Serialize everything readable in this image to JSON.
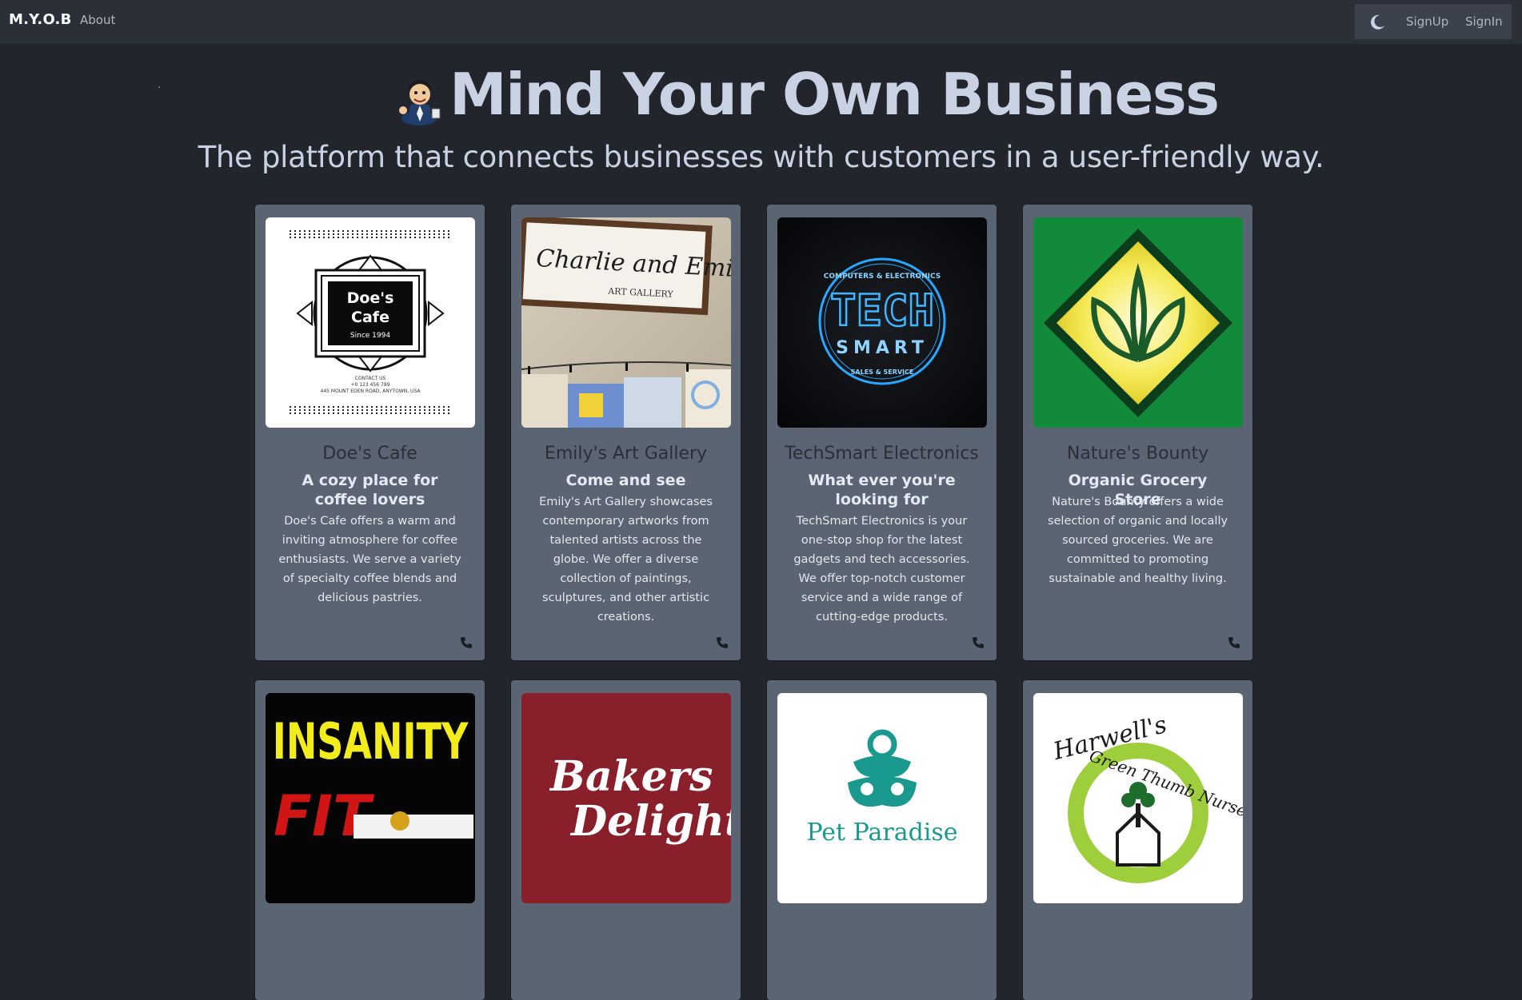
{
  "navbar": {
    "brand": "M.Y.O.B",
    "about": "About",
    "theme_icon": "moon-icon",
    "signup": "SignUp",
    "signin": "SignIn"
  },
  "hero": {
    "mascot_icon": "businessman-mascot-icon",
    "title": "Mind Your Own Business",
    "subtitle": "The platform that connects businesses with customers in a user-friendly way."
  },
  "businesses": [
    {
      "name": "Doe's Cafe",
      "tagline": "A cozy place for coffee lovers",
      "description": "Doe's Cafe offers a warm and inviting atmosphere for coffee enthusiasts. We serve a variety of specialty coffee blends and delicious pastries.",
      "logo_text": {
        "line1": "Doe's",
        "line2": "Cafe",
        "since": "Since 1994",
        "contact": "CONTACT US",
        "phone": "+0 123 456 789",
        "address": "445 MOUNT EDEN ROAD, ANYTOWN, USA"
      },
      "contact_icon": "phone-icon"
    },
    {
      "name": "Emily's Art Gallery",
      "tagline": "Come and see",
      "description": "Emily's Art Gallery showcases contemporary artworks from talented artists across the globe. We offer a diverse collection of paintings, sculptures, and other artistic creations.",
      "logo_text": {
        "line1": "Charlie and Emily's",
        "line2": "ART GALLERY"
      },
      "contact_icon": "phone-icon"
    },
    {
      "name": "TechSmart Electronics",
      "tagline": "What ever you're looking for",
      "description": "TechSmart Electronics is your one-stop shop for the latest gadgets and tech accessories. We offer top-notch customer service and a wide range of cutting-edge products.",
      "logo_text": {
        "top": "COMPUTERS & ELECTRONICS",
        "line1": "TECH",
        "line2": "SMART",
        "bottom": "SALES & SERVICE"
      },
      "contact_icon": "phone-icon"
    },
    {
      "name": "Nature's Bounty",
      "tagline": "Organic Grocery Store",
      "description": "Nature's Bounty offers a wide selection of organic and locally sourced groceries. We are committed to promoting sustainable and healthy living.",
      "contact_icon": "phone-icon"
    },
    {
      "logo_text": {
        "line1": "INSANITY",
        "line2": "FIT"
      }
    },
    {
      "logo_text": {
        "line1": "Bakers",
        "line2": "Delight"
      }
    },
    {
      "logo_text": {
        "line1": "Pet Paradise"
      }
    },
    {
      "logo_text": {
        "line1": "Harwell's",
        "line2": "Green Thumb Nursery"
      }
    }
  ],
  "colors": {
    "page_bg": "#22252b",
    "navbar_bg": "#2b3038",
    "card_bg": "#5a6472",
    "title": "#c8d2e3"
  }
}
